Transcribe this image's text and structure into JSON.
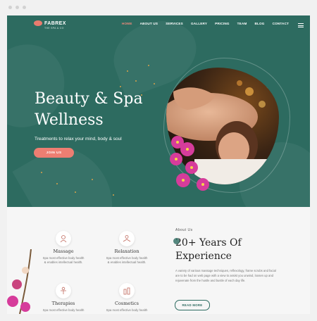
{
  "window": {
    "controls": [
      "close",
      "minimize",
      "maximize"
    ]
  },
  "brand": {
    "name": "FABREX",
    "tagline": "THE SPA & CO"
  },
  "nav": {
    "items": [
      "HOME",
      "ABOUT US",
      "SERVICES",
      "GALLERY",
      "PRICING",
      "TEAM",
      "BLOG",
      "CONTACT"
    ],
    "active": "HOME"
  },
  "hero": {
    "title_line1": "Beauty & Spa",
    "title_line2": "Wellness",
    "subtitle": "Treatments to relax your mind, body & soul",
    "button": "JOIN US"
  },
  "services": [
    {
      "icon": "massage-icon",
      "title": "Massage",
      "desc_line1": "Spa most effective body health",
      "desc_line2": "& enables intellectual health."
    },
    {
      "icon": "relaxation-icon",
      "title": "Relaxation",
      "desc_line1": "Spa most effective body health",
      "desc_line2": "& enables intellectual health."
    },
    {
      "icon": "therapies-icon",
      "title": "Therapies",
      "desc_line1": "Spa most effective body health",
      "desc_line2": ""
    },
    {
      "icon": "cosmetics-icon",
      "title": "Cosmetics",
      "desc_line1": "Spa most effective body health",
      "desc_line2": ""
    }
  ],
  "about": {
    "label": "About Us",
    "title_line1": "20+ Years Of",
    "title_line2": "Experience",
    "body": "A variety of various massage techniques, reflexology, frame scrubs and facial are to be had on web page with a view to assist you unwind, loosen up and rejuvenate from the hustle and bustle of each day life.",
    "button": "READ MORE"
  },
  "colors": {
    "accent": "#2d6b60",
    "brand": "#ec7e72"
  }
}
